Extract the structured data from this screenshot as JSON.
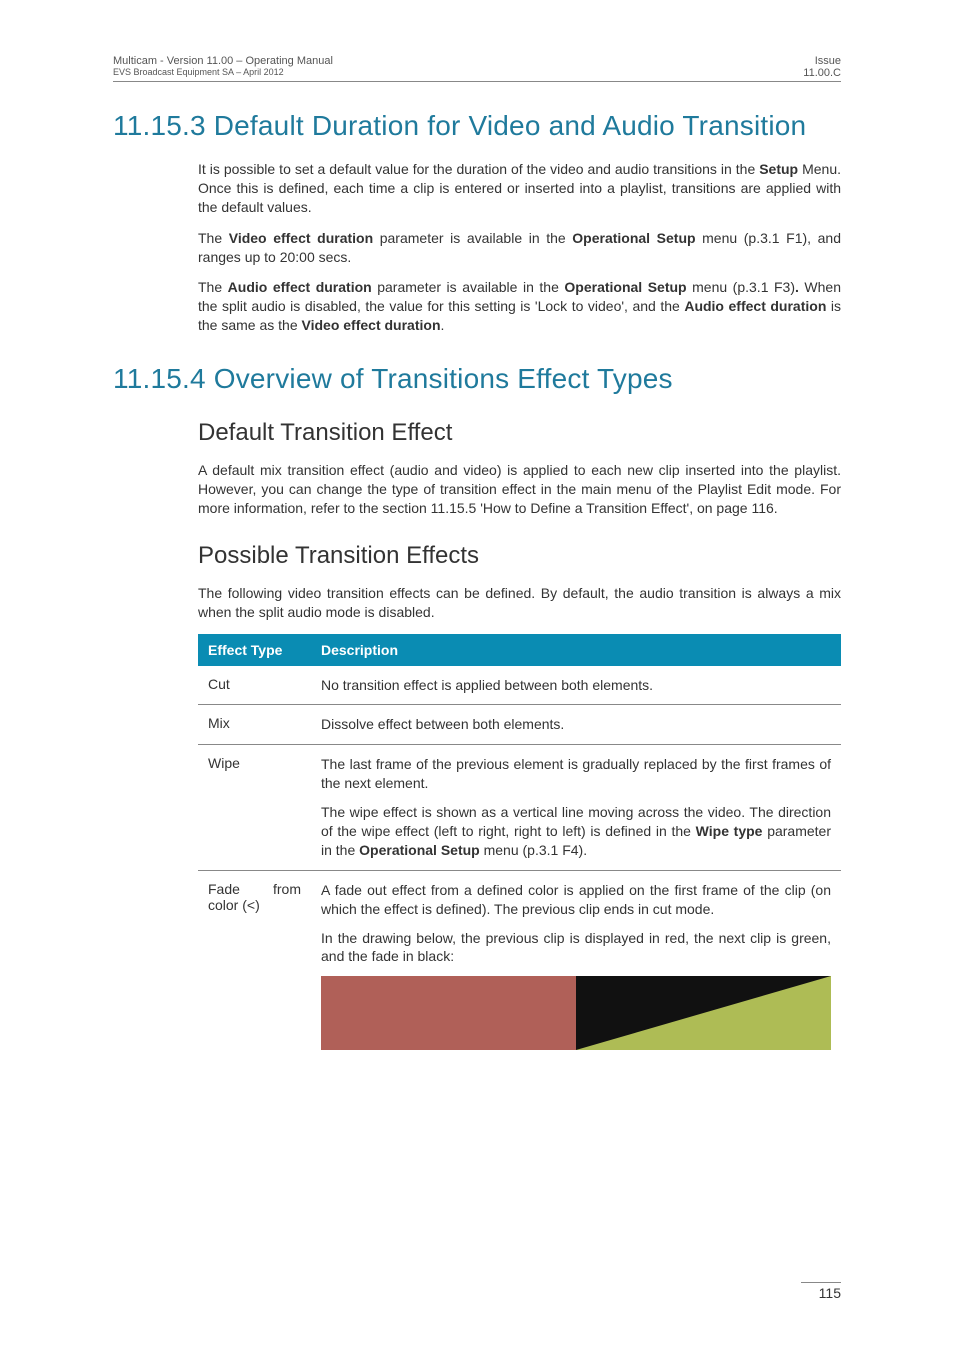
{
  "header": {
    "left_line1": "Multicam - Version 11.00 – Operating Manual",
    "left_line2": "EVS Broadcast Equipment SA – April 2012",
    "right_line1": "Issue",
    "right_line2": "11.00.C"
  },
  "section_11_15_3": {
    "title": "11.15.3  Default Duration for Video and Audio Transition",
    "para1_a": "It is possible to set a default value for the duration of the video and audio transitions in the ",
    "para1_b": "Setup",
    "para1_c": " Menu. Once this is defined, each time a clip is entered or inserted into a playlist, transitions are applied with the default values.",
    "para2_a": "The ",
    "para2_b": "Video effect duration",
    "para2_c": " parameter is available in the ",
    "para2_d": "Operational Setup",
    "para2_e": " menu (p.3.1 F1), and ranges up to 20:00 secs.",
    "para3_a": "The ",
    "para3_b": "Audio effect duration",
    "para3_c": " parameter is available in the ",
    "para3_d": "Operational Setup",
    "para3_e": " menu (p.3.1 F3)",
    "para3_f": ".",
    "para3_g": " When the split audio is disabled, the value for this setting is 'Lock to video', and the ",
    "para3_h": "Audio effect duration",
    "para3_i": " is the same as the ",
    "para3_j": "Video effect duration",
    "para3_k": "."
  },
  "section_11_15_4": {
    "title": "11.15.4  Overview of Transitions Effect Types",
    "sub1_title": "Default Transition Effect",
    "sub1_para": "A default mix transition effect (audio and video) is applied to each new clip inserted into the playlist. However, you can change the type of transition effect in the main menu of the Playlist Edit mode. For more information, refer to the section 11.15.5 'How to Define a Transition Effect', on page 116.",
    "sub2_title": "Possible Transition Effects",
    "sub2_para": "The following video transition effects can be defined. By default, the audio transition is always a mix when the split audio mode is disabled.",
    "table": {
      "head_col1": "Effect Type",
      "head_col2": "Description",
      "rows": [
        {
          "type": "Cut",
          "desc": [
            {
              "plain": "No transition effect is applied between both elements."
            }
          ]
        },
        {
          "type": "Mix",
          "desc": [
            {
              "plain": "Dissolve effect between both elements."
            }
          ]
        },
        {
          "type": "Wipe",
          "desc": [
            {
              "plain": "The last frame of the previous element is gradually replaced by the first frames of the next element."
            },
            {
              "p_a": "The wipe effect is shown as a vertical line moving across the video. The direction of the wipe effect (left to right, right to left) is defined in the ",
              "p_b": "Wipe type",
              "p_c": " parameter in the ",
              "p_d": "Operational Setup",
              "p_e": " menu (p.3.1 F4)."
            }
          ]
        },
        {
          "type_left": "Fade",
          "type_right": "from",
          "type_line2": "color (<)",
          "desc": [
            {
              "plain": "A fade out effect from a defined color is applied on the first frame of the clip (on which the effect is defined). The previous clip ends in cut mode."
            },
            {
              "plain": "In the drawing below, the previous clip is displayed in red, the next clip is green, and the fade in black:"
            }
          ],
          "has_diagram": true
        }
      ]
    }
  },
  "page_number": "115"
}
